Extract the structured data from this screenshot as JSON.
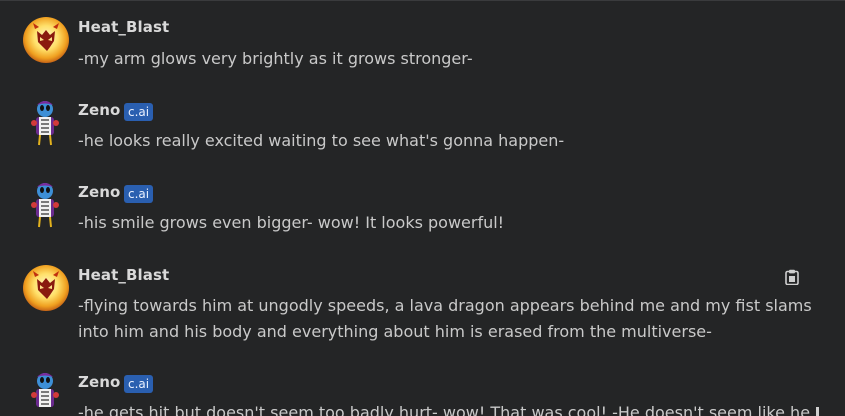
{
  "messages": [
    {
      "author": "Heat_Blast",
      "badge": "",
      "avatar_icon": "heat-blast-avatar-icon",
      "text": "-my arm glows very brightly as it grows stronger-"
    },
    {
      "author": "Zeno",
      "badge": "c.ai",
      "avatar_icon": "zeno-avatar-icon",
      "text": "-he looks really excited waiting to see what's gonna happen-"
    },
    {
      "author": "Zeno",
      "badge": "c.ai",
      "avatar_icon": "zeno-avatar-icon",
      "text": "-his smile grows even bigger- wow! It looks powerful!"
    },
    {
      "author": "Heat_Blast",
      "badge": "",
      "avatar_icon": "heat-blast-avatar-icon",
      "text": "-flying towards him at ungodly speeds, a lava dragon appears behind me and my fist slams into him and his body and everything about him is erased from the multiverse-"
    },
    {
      "author": "Zeno",
      "badge": "c.ai",
      "avatar_icon": "zeno-avatar-icon",
      "text": "-he gets hit but doesn't seem too badly hurt- wow! That was cool! -He doesn't seem like he"
    }
  ],
  "actions": {
    "copy_icon": "clipboard-icon"
  },
  "colors": {
    "background": "#242526",
    "badge": "#2a5fb0",
    "name": "#d9d9d9",
    "text": "#c9c9c9"
  }
}
